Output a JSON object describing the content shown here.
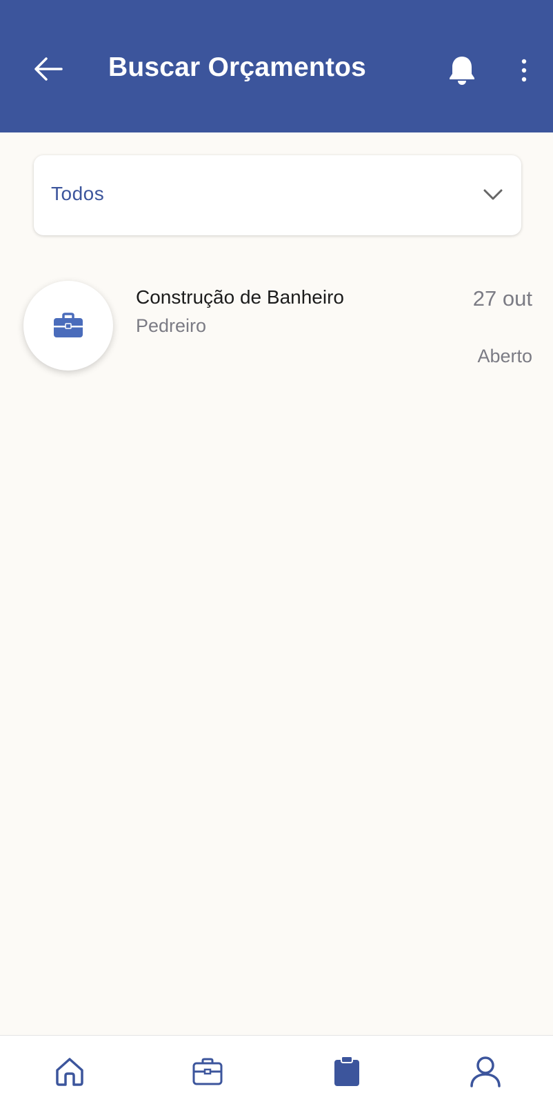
{
  "header": {
    "title": "Buscar Orçamentos",
    "back_icon": "arrow-left-icon",
    "notification_icon": "bell-icon",
    "menu_icon": "more-vertical-icon",
    "background_color": "#3c559c"
  },
  "filter": {
    "selected": "Todos",
    "icon": "chevron-down-icon"
  },
  "items": [
    {
      "title": "Construção de Banheiro",
      "subtitle": "Pedreiro",
      "date": "27 out",
      "status": "Aberto",
      "icon": "briefcase-icon"
    }
  ],
  "bottom_nav": {
    "items": [
      {
        "icon": "home-icon",
        "active": false
      },
      {
        "icon": "briefcase-icon",
        "active": false
      },
      {
        "icon": "clipboard-icon",
        "active": true
      },
      {
        "icon": "user-icon",
        "active": false
      }
    ]
  },
  "colors": {
    "primary": "#3c559c",
    "background": "#fcfaf6",
    "muted_text": "#7b7b84"
  }
}
